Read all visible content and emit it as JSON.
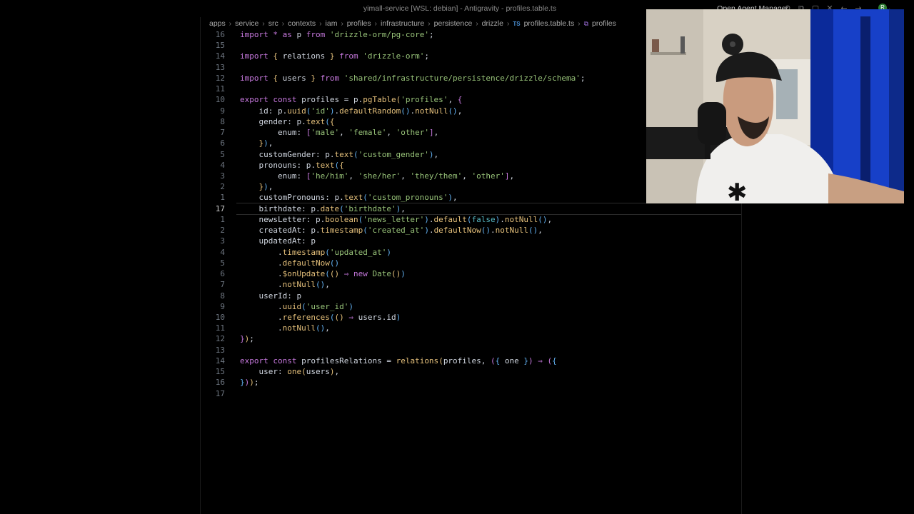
{
  "window": {
    "title": "yimall-service [WSL: debian] - Antigravity - profiles.table.ts",
    "agent_manager_label": "Open Agent Manager",
    "account_initial": "R"
  },
  "breadcrumbs": [
    {
      "label": "apps"
    },
    {
      "label": "service"
    },
    {
      "label": "src"
    },
    {
      "label": "contexts"
    },
    {
      "label": "iam"
    },
    {
      "label": "profiles"
    },
    {
      "label": "infrastructure"
    },
    {
      "label": "persistence"
    },
    {
      "label": "drizzle"
    },
    {
      "label": "profiles.table.ts",
      "icon": "TS"
    },
    {
      "label": "profiles",
      "icon": "symbol"
    }
  ],
  "editor": {
    "current_line_index": 16,
    "lines": [
      {
        "n": "16",
        "tokens": [
          [
            "kw",
            "import"
          ],
          [
            "pl",
            " "
          ],
          [
            "op",
            "*"
          ],
          [
            "pl",
            " "
          ],
          [
            "kw",
            "as"
          ],
          [
            "pl",
            " p "
          ],
          [
            "kw",
            "from"
          ],
          [
            "pl",
            " "
          ],
          [
            "str",
            "'drizzle-orm/pg-core'"
          ],
          [
            "pl",
            ";"
          ]
        ]
      },
      {
        "n": "15",
        "tokens": []
      },
      {
        "n": "14",
        "tokens": [
          [
            "kw",
            "import"
          ],
          [
            "pl",
            " "
          ],
          [
            "br1",
            "{"
          ],
          [
            "pl",
            " relations "
          ],
          [
            "br1",
            "}"
          ],
          [
            "pl",
            " "
          ],
          [
            "kw",
            "from"
          ],
          [
            "pl",
            " "
          ],
          [
            "str",
            "'drizzle-orm'"
          ],
          [
            "pl",
            ";"
          ]
        ]
      },
      {
        "n": "13",
        "tokens": []
      },
      {
        "n": "12",
        "tokens": [
          [
            "kw",
            "import"
          ],
          [
            "pl",
            " "
          ],
          [
            "br1",
            "{"
          ],
          [
            "pl",
            " users "
          ],
          [
            "br1",
            "}"
          ],
          [
            "pl",
            " "
          ],
          [
            "kw",
            "from"
          ],
          [
            "pl",
            " "
          ],
          [
            "str",
            "'shared/infrastructure/persistence/drizzle/schema'"
          ],
          [
            "pl",
            ";"
          ]
        ]
      },
      {
        "n": "11",
        "tokens": []
      },
      {
        "n": "10",
        "tokens": [
          [
            "kw",
            "export"
          ],
          [
            "pl",
            " "
          ],
          [
            "kw",
            "const"
          ],
          [
            "pl",
            " profiles = p."
          ],
          [
            "fn",
            "pgTable"
          ],
          [
            "br1",
            "("
          ],
          [
            "str",
            "'profiles'"
          ],
          [
            "pl",
            ", "
          ],
          [
            "br2",
            "{"
          ]
        ]
      },
      {
        "n": "9",
        "tokens": [
          [
            "pl",
            "    id: p."
          ],
          [
            "fn",
            "uuid"
          ],
          [
            "br3",
            "("
          ],
          [
            "str",
            "'id'"
          ],
          [
            "br3",
            ")"
          ],
          [
            "pl",
            "."
          ],
          [
            "fn",
            "defaultRandom"
          ],
          [
            "br3",
            "()"
          ],
          [
            "pl",
            "."
          ],
          [
            "fn",
            "notNull"
          ],
          [
            "br3",
            "()"
          ],
          [
            "pl",
            ","
          ]
        ]
      },
      {
        "n": "8",
        "tokens": [
          [
            "pl",
            "    gender: p."
          ],
          [
            "fn",
            "text"
          ],
          [
            "br3",
            "("
          ],
          [
            "br1",
            "{"
          ]
        ]
      },
      {
        "n": "7",
        "tokens": [
          [
            "pl",
            "        enum: "
          ],
          [
            "br2",
            "["
          ],
          [
            "str",
            "'male'"
          ],
          [
            "pl",
            ", "
          ],
          [
            "str",
            "'female'"
          ],
          [
            "pl",
            ", "
          ],
          [
            "str",
            "'other'"
          ],
          [
            "br2",
            "]"
          ],
          [
            "pl",
            ","
          ]
        ]
      },
      {
        "n": "6",
        "tokens": [
          [
            "pl",
            "    "
          ],
          [
            "br1",
            "}"
          ],
          [
            "br3",
            ")"
          ],
          [
            "pl",
            ","
          ]
        ]
      },
      {
        "n": "5",
        "tokens": [
          [
            "pl",
            "    customGender: p."
          ],
          [
            "fn",
            "text"
          ],
          [
            "br3",
            "("
          ],
          [
            "str",
            "'custom_gender'"
          ],
          [
            "br3",
            ")"
          ],
          [
            "pl",
            ","
          ]
        ]
      },
      {
        "n": "4",
        "tokens": [
          [
            "pl",
            "    pronouns: p."
          ],
          [
            "fn",
            "text"
          ],
          [
            "br3",
            "("
          ],
          [
            "br1",
            "{"
          ]
        ]
      },
      {
        "n": "3",
        "tokens": [
          [
            "pl",
            "        enum: "
          ],
          [
            "br2",
            "["
          ],
          [
            "str",
            "'he/him'"
          ],
          [
            "pl",
            ", "
          ],
          [
            "str",
            "'she/her'"
          ],
          [
            "pl",
            ", "
          ],
          [
            "str",
            "'they/them'"
          ],
          [
            "pl",
            ", "
          ],
          [
            "str",
            "'other'"
          ],
          [
            "br2",
            "]"
          ],
          [
            "pl",
            ","
          ]
        ]
      },
      {
        "n": "2",
        "tokens": [
          [
            "pl",
            "    "
          ],
          [
            "br1",
            "}"
          ],
          [
            "br3",
            ")"
          ],
          [
            "pl",
            ","
          ]
        ]
      },
      {
        "n": "1",
        "tokens": [
          [
            "pl",
            "    customPronouns: p."
          ],
          [
            "fn",
            "text"
          ],
          [
            "br3",
            "("
          ],
          [
            "str",
            "'custom_pronouns'"
          ],
          [
            "br3",
            ")"
          ],
          [
            "pl",
            ","
          ]
        ]
      },
      {
        "n": "17",
        "tokens": [
          [
            "pl",
            "    birthdate: p."
          ],
          [
            "fn",
            "date"
          ],
          [
            "br3",
            "("
          ],
          [
            "str",
            "'birthdate'"
          ],
          [
            "br3",
            ")"
          ],
          [
            "pl",
            ","
          ]
        ]
      },
      {
        "n": "1",
        "tokens": [
          [
            "pl",
            "    newsLetter: p."
          ],
          [
            "fn",
            "boolean"
          ],
          [
            "br3",
            "("
          ],
          [
            "str",
            "'news_letter'"
          ],
          [
            "br3",
            ")"
          ],
          [
            "pl",
            "."
          ],
          [
            "fn",
            "default"
          ],
          [
            "br3",
            "("
          ],
          [
            "kw2",
            "false"
          ],
          [
            "br3",
            ")"
          ],
          [
            "pl",
            "."
          ],
          [
            "fn",
            "notNull"
          ],
          [
            "br3",
            "()"
          ],
          [
            "pl",
            ","
          ]
        ]
      },
      {
        "n": "2",
        "tokens": [
          [
            "pl",
            "    createdAt: p."
          ],
          [
            "fn",
            "timestamp"
          ],
          [
            "br3",
            "("
          ],
          [
            "str",
            "'created_at'"
          ],
          [
            "br3",
            ")"
          ],
          [
            "pl",
            "."
          ],
          [
            "fn",
            "defaultNow"
          ],
          [
            "br3",
            "()"
          ],
          [
            "pl",
            "."
          ],
          [
            "fn",
            "notNull"
          ],
          [
            "br3",
            "()"
          ],
          [
            "pl",
            ","
          ]
        ]
      },
      {
        "n": "3",
        "tokens": [
          [
            "pl",
            "    updatedAt: p"
          ]
        ]
      },
      {
        "n": "4",
        "tokens": [
          [
            "pl",
            "        ."
          ],
          [
            "fn",
            "timestamp"
          ],
          [
            "br3",
            "("
          ],
          [
            "str",
            "'updated_at'"
          ],
          [
            "br3",
            ")"
          ]
        ]
      },
      {
        "n": "5",
        "tokens": [
          [
            "pl",
            "        ."
          ],
          [
            "fn",
            "defaultNow"
          ],
          [
            "br3",
            "()"
          ]
        ]
      },
      {
        "n": "6",
        "tokens": [
          [
            "pl",
            "        ."
          ],
          [
            "fn",
            "$onUpdate"
          ],
          [
            "br3",
            "("
          ],
          [
            "br1",
            "()"
          ],
          [
            "pl",
            " "
          ],
          [
            "op",
            "⇒"
          ],
          [
            "pl",
            " "
          ],
          [
            "kw",
            "new"
          ],
          [
            "pl",
            " "
          ],
          [
            "cls",
            "Date"
          ],
          [
            "br1",
            "()"
          ],
          [
            "br3",
            ")"
          ]
        ]
      },
      {
        "n": "7",
        "tokens": [
          [
            "pl",
            "        ."
          ],
          [
            "fn",
            "notNull"
          ],
          [
            "br3",
            "()"
          ],
          [
            "pl",
            ","
          ]
        ]
      },
      {
        "n": "8",
        "tokens": [
          [
            "pl",
            "    userId: p"
          ]
        ]
      },
      {
        "n": "9",
        "tokens": [
          [
            "pl",
            "        ."
          ],
          [
            "fn",
            "uuid"
          ],
          [
            "br3",
            "("
          ],
          [
            "str",
            "'user_id'"
          ],
          [
            "br3",
            ")"
          ]
        ]
      },
      {
        "n": "10",
        "tokens": [
          [
            "pl",
            "        ."
          ],
          [
            "fn",
            "references"
          ],
          [
            "br3",
            "("
          ],
          [
            "br1",
            "()"
          ],
          [
            "pl",
            " "
          ],
          [
            "op",
            "⇒"
          ],
          [
            "pl",
            " users.id"
          ],
          [
            "br3",
            ")"
          ]
        ]
      },
      {
        "n": "11",
        "tokens": [
          [
            "pl",
            "        ."
          ],
          [
            "fn",
            "notNull"
          ],
          [
            "br3",
            "()"
          ],
          [
            "pl",
            ","
          ]
        ]
      },
      {
        "n": "12",
        "tokens": [
          [
            "br2",
            "}"
          ],
          [
            "br1",
            ")"
          ],
          [
            "pl",
            ";"
          ]
        ]
      },
      {
        "n": "13",
        "tokens": []
      },
      {
        "n": "14",
        "tokens": [
          [
            "kw",
            "export"
          ],
          [
            "pl",
            " "
          ],
          [
            "kw",
            "const"
          ],
          [
            "pl",
            " profilesRelations = "
          ],
          [
            "fn",
            "relations"
          ],
          [
            "br1",
            "("
          ],
          [
            "pl",
            "profiles, "
          ],
          [
            "br2",
            "("
          ],
          [
            "br3",
            "{"
          ],
          [
            "pl",
            " one "
          ],
          [
            "br3",
            "}"
          ],
          [
            "br2",
            ")"
          ],
          [
            "pl",
            " "
          ],
          [
            "op",
            "⇒"
          ],
          [
            "pl",
            " "
          ],
          [
            "br2",
            "("
          ],
          [
            "br3",
            "{"
          ]
        ]
      },
      {
        "n": "15",
        "tokens": [
          [
            "pl",
            "    user: "
          ],
          [
            "fn",
            "one"
          ],
          [
            "br1",
            "("
          ],
          [
            "pl",
            "users"
          ],
          [
            "br1",
            ")"
          ],
          [
            "pl",
            ","
          ]
        ]
      },
      {
        "n": "16",
        "tokens": [
          [
            "br3",
            "}"
          ],
          [
            "br2",
            ")"
          ],
          [
            "br1",
            ")"
          ],
          [
            "pl",
            ";"
          ]
        ]
      },
      {
        "n": "17",
        "tokens": []
      }
    ]
  },
  "colors": {
    "pl": "#d0d6e0",
    "kw": "#c678dd",
    "kw2": "#56b6c2",
    "str": "#98c379",
    "fn": "#e5c07b",
    "br1": "#e5c07b",
    "br2": "#c678dd",
    "br3": "#61afef",
    "op": "#c678dd",
    "cls": "#98c379"
  }
}
